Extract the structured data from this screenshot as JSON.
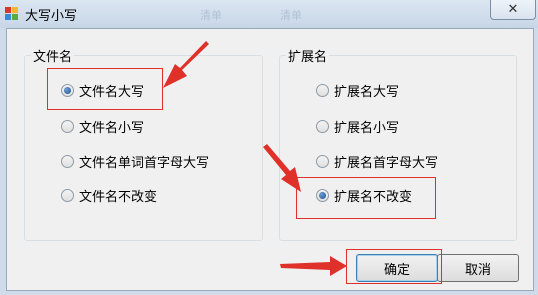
{
  "window": {
    "title": "大写小写",
    "ghost_text": [
      "清单",
      "清单"
    ],
    "close_glyph": "✕"
  },
  "filename_group": {
    "title": "文件名",
    "options": [
      {
        "label": "文件名大写",
        "checked": true
      },
      {
        "label": "文件名小写",
        "checked": false
      },
      {
        "label": "文件名单词首字母大写",
        "checked": false
      },
      {
        "label": "文件名不改变",
        "checked": false
      }
    ]
  },
  "extension_group": {
    "title": "扩展名",
    "options": [
      {
        "label": "扩展名大写",
        "checked": false
      },
      {
        "label": "扩展名小写",
        "checked": false
      },
      {
        "label": "扩展名首字母大写",
        "checked": false
      },
      {
        "label": "扩展名不改变",
        "checked": true
      }
    ]
  },
  "buttons": {
    "ok": "确定",
    "cancel": "取消"
  },
  "colors": {
    "annotation": "#e0302a",
    "accent": "#1c4d8a"
  }
}
